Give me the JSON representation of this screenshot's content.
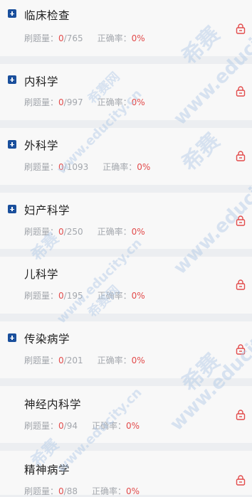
{
  "labels": {
    "questions": "刷题量：",
    "accuracy": "正确率："
  },
  "colors": {
    "accent_red": "#e24b4b",
    "expand_blue": "#1a4f9c",
    "topbar_blue": "#1d5fb3"
  },
  "watermark": {
    "brand": "希赛",
    "site": "www.educity.cn",
    "net": "希赛网"
  },
  "subjects": [
    {
      "title": "临床检查",
      "done": "0",
      "total": "/765",
      "accuracy": "0%",
      "expandable": true,
      "locked": true
    },
    {
      "title": "内科学",
      "done": "0",
      "total": "/997",
      "accuracy": "0%",
      "expandable": true,
      "locked": true
    },
    {
      "title": "外科学",
      "done": "0",
      "total": "/1093",
      "accuracy": "0%",
      "expandable": true,
      "locked": true
    },
    {
      "title": "妇产科学",
      "done": "0",
      "total": "/250",
      "accuracy": "0%",
      "expandable": true,
      "locked": true
    },
    {
      "title": "儿科学",
      "done": "0",
      "total": "/195",
      "accuracy": "0%",
      "expandable": false,
      "locked": true
    },
    {
      "title": "传染病学",
      "done": "0",
      "total": "/201",
      "accuracy": "0%",
      "expandable": true,
      "locked": true
    },
    {
      "title": "神经内科学",
      "done": "0",
      "total": "/94",
      "accuracy": "0%",
      "expandable": false,
      "locked": true
    },
    {
      "title": "精神病学",
      "done": "0",
      "total": "/88",
      "accuracy": "0%",
      "expandable": false,
      "locked": true
    }
  ]
}
